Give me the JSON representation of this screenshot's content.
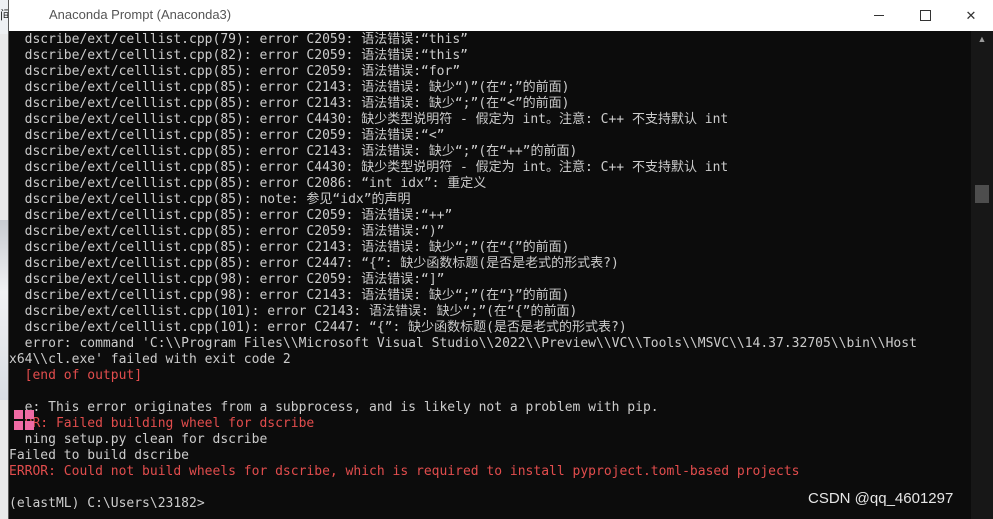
{
  "background": {
    "title_fragment": "间",
    "plus": "+"
  },
  "window": {
    "title": "Anaconda Prompt (Anaconda3)",
    "min_label": "",
    "close_label": "✕"
  },
  "console": {
    "lines": [
      {
        "text": "  dscribe/ext/celllist.cpp(79): error C2059: 语法错误:“this”",
        "type": "normal"
      },
      {
        "text": "  dscribe/ext/celllist.cpp(82): error C2059: 语法错误:“this”",
        "type": "normal"
      },
      {
        "text": "  dscribe/ext/celllist.cpp(85): error C2059: 语法错误:“for”",
        "type": "normal"
      },
      {
        "text": "  dscribe/ext/celllist.cpp(85): error C2143: 语法错误: 缺少“)”(在“;”的前面)",
        "type": "normal"
      },
      {
        "text": "  dscribe/ext/celllist.cpp(85): error C2143: 语法错误: 缺少“;”(在“<”的前面)",
        "type": "normal"
      },
      {
        "text": "  dscribe/ext/celllist.cpp(85): error C4430: 缺少类型说明符 - 假定为 int。注意: C++ 不支持默认 int",
        "type": "normal"
      },
      {
        "text": "  dscribe/ext/celllist.cpp(85): error C2059: 语法错误:“<”",
        "type": "normal"
      },
      {
        "text": "  dscribe/ext/celllist.cpp(85): error C2143: 语法错误: 缺少“;”(在“++”的前面)",
        "type": "normal"
      },
      {
        "text": "  dscribe/ext/celllist.cpp(85): error C4430: 缺少类型说明符 - 假定为 int。注意: C++ 不支持默认 int",
        "type": "normal"
      },
      {
        "text": "  dscribe/ext/celllist.cpp(85): error C2086: “int idx”: 重定义",
        "type": "normal"
      },
      {
        "text": "  dscribe/ext/celllist.cpp(85): note: 参见“idx”的声明",
        "type": "normal"
      },
      {
        "text": "  dscribe/ext/celllist.cpp(85): error C2059: 语法错误:“++”",
        "type": "normal"
      },
      {
        "text": "  dscribe/ext/celllist.cpp(85): error C2059: 语法错误:“)”",
        "type": "normal"
      },
      {
        "text": "  dscribe/ext/celllist.cpp(85): error C2143: 语法错误: 缺少“;”(在“{”的前面)",
        "type": "normal"
      },
      {
        "text": "  dscribe/ext/celllist.cpp(85): error C2447: “{”: 缺少函数标题(是否是老式的形式表?)",
        "type": "normal"
      },
      {
        "text": "  dscribe/ext/celllist.cpp(98): error C2059: 语法错误:“]”",
        "type": "normal"
      },
      {
        "text": "  dscribe/ext/celllist.cpp(98): error C2143: 语法错误: 缺少“;”(在“}”的前面)",
        "type": "normal"
      },
      {
        "text": "  dscribe/ext/celllist.cpp(101): error C2143: 语法错误: 缺少“;”(在“{”的前面)",
        "type": "normal"
      },
      {
        "text": "  dscribe/ext/celllist.cpp(101): error C2447: “{”: 缺少函数标题(是否是老式的形式表?)",
        "type": "normal"
      },
      {
        "text": "  error: command 'C:\\\\Program Files\\\\Microsoft Visual Studio\\\\2022\\\\Preview\\\\VC\\\\Tools\\\\MSVC\\\\14.37.32705\\\\bin\\\\Host",
        "type": "normal"
      },
      {
        "text": "x64\\\\cl.exe' failed with exit code 2",
        "type": "normal"
      },
      {
        "text": "  [end of output]",
        "type": "err"
      },
      {
        "text": "",
        "type": "normal"
      },
      {
        "text": "  e: This error originates from a subprocess, and is likely not a problem with pip.",
        "type": "normal"
      },
      {
        "text": "  OR: Failed building wheel for dscribe",
        "type": "err"
      },
      {
        "text": "  ning setup.py clean for dscribe",
        "type": "normal"
      },
      {
        "text": "Failed to build dscribe",
        "type": "normal"
      },
      {
        "text": "ERROR: Could not build wheels for dscribe, which is required to install pyproject.toml-based projects",
        "type": "err"
      },
      {
        "text": "",
        "type": "normal"
      },
      {
        "text": "(elastML) C:\\Users\\23182>",
        "type": "normal"
      }
    ]
  },
  "scrollbar": {
    "up_arrow": "▲"
  },
  "watermark": "CSDN @qq_4601297",
  "colors": {
    "console_bg": "#0c0c0c",
    "console_text": "#cccccc",
    "error_text": "#e24d4d",
    "accent_pink": "#ef6aa3"
  }
}
